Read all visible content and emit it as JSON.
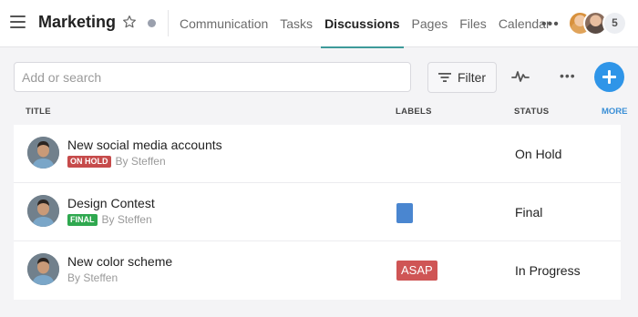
{
  "header": {
    "menu_icon": "hamburger-icon",
    "project_title": "Marketing",
    "star_icon": "star-outline-icon",
    "tabs": [
      {
        "label": "Communication",
        "active": false
      },
      {
        "label": "Tasks",
        "active": false
      },
      {
        "label": "Discussions",
        "active": true
      },
      {
        "label": "Pages",
        "active": false
      },
      {
        "label": "Files",
        "active": false
      },
      {
        "label": "Calendar",
        "active": false
      }
    ],
    "more_label": "•••",
    "member_count": "5",
    "accent_color": "#3d9a9a"
  },
  "toolbar": {
    "search_placeholder": "Add or search",
    "search_value": "",
    "filter_label": "Filter",
    "filter_icon": "filter-icon",
    "activity_icon": "activity-icon",
    "more_label": "•••",
    "add_icon": "plus-icon",
    "add_color": "#2f95e8"
  },
  "columns": {
    "title": "TITLE",
    "labels": "LABELS",
    "status": "STATUS",
    "more": "MORE"
  },
  "discussions": [
    {
      "title": "New social media accounts",
      "badge": "ON HOLD",
      "author": "By Steffen",
      "label": "",
      "status": "On Hold"
    },
    {
      "title": "Design Contest",
      "badge": "FINAL",
      "author": "By Steffen",
      "label": "",
      "label_color": "#4a86d0",
      "status": "Final"
    },
    {
      "title": "New color scheme",
      "badge": "",
      "author": "By Steffen",
      "label": "ASAP",
      "label_color": "#cf5555",
      "status": "In Progress"
    }
  ]
}
